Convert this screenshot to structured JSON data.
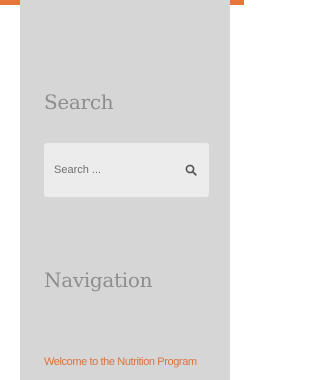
{
  "search_widget": {
    "title": "Search",
    "placeholder": "Search ...",
    "button_icon": "search-icon"
  },
  "navigation_widget": {
    "title": "Navigation",
    "links": [
      {
        "label": "Welcome to the Nutrition Program"
      }
    ]
  },
  "colors": {
    "accent": "#e8763a",
    "sidebar_bg": "#d6d6d6",
    "link": "#d9733f"
  }
}
